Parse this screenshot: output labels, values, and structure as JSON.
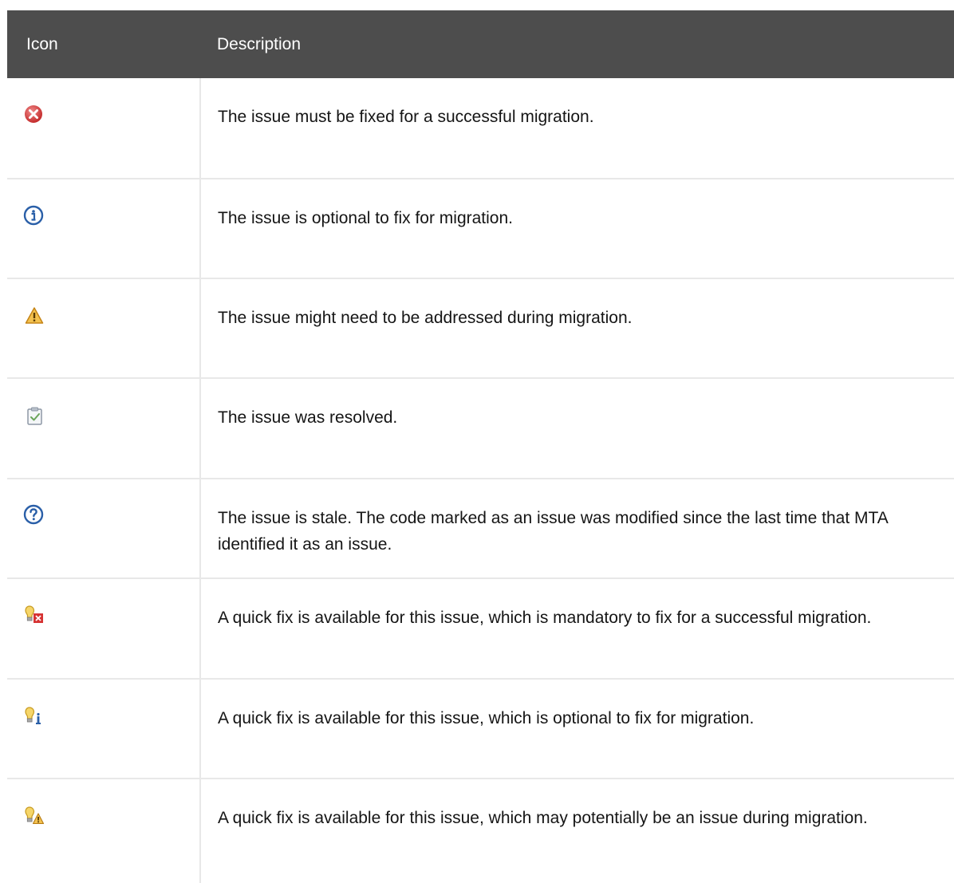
{
  "table": {
    "headers": {
      "icon": "Icon",
      "description": "Description"
    },
    "rows": [
      {
        "icon": "error-circle-icon",
        "description": "The issue must be fixed for a successful migration."
      },
      {
        "icon": "info-circle-icon",
        "description": "The issue is optional to fix for migration."
      },
      {
        "icon": "warning-triangle-icon",
        "description": "The issue might need to be addressed during migration."
      },
      {
        "icon": "resolved-clipboard-check-icon",
        "description": "The issue was resolved."
      },
      {
        "icon": "stale-question-icon",
        "description": "The issue is stale. The code marked as an issue was modified since the last time that MTA identified it as an issue."
      },
      {
        "icon": "quickfix-bulb-error-icon",
        "description": "A quick fix is available for this issue, which is mandatory to fix for a successful migration."
      },
      {
        "icon": "quickfix-bulb-info-icon",
        "description": "A quick fix is available for this issue, which is optional to fix for migration."
      },
      {
        "icon": "quickfix-bulb-warning-icon",
        "description": "A quick fix is available for this issue, which may potentially be an issue during migration."
      }
    ]
  },
  "colors": {
    "header_bg": "#4d4d4d",
    "header_text": "#ffffff",
    "border": "#e8e8e8",
    "error": "#d33a3a",
    "info": "#2a5fa8",
    "warning": "#e9a93c"
  }
}
